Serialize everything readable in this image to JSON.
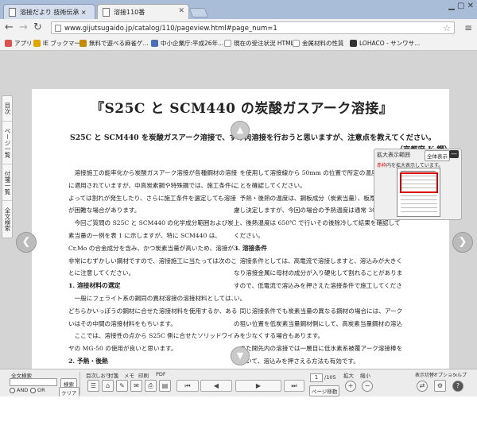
{
  "browser": {
    "tabs": [
      {
        "title": "溶接だより 技術伝承 ×"
      },
      {
        "title": "溶接110番"
      }
    ],
    "url": "www.gijutsugaido.jp/catalog/110/pageview.html#page_num=1",
    "bookmarks": [
      {
        "label": "アプリ",
        "color": "#d9534f"
      },
      {
        "label": "IE ブックマーク",
        "color": "#e0a400"
      },
      {
        "label": "無料で遊べる麻雀ゲ...",
        "color": "#c58b00"
      },
      {
        "label": "中小企業庁:平成26年...",
        "color": "#4a6fb5"
      },
      {
        "label": "現在の受注状況 HTML",
        "color": "#d0d0d0"
      },
      {
        "label": "金属材料の性質",
        "color": "#d0d0d0"
      },
      {
        "label": "LOHACO - サンワサ...",
        "color": "#333333"
      }
    ]
  },
  "sidebar": {
    "tabs": [
      "目次",
      "ページ一覧",
      "付箋一覧",
      "全文検索"
    ]
  },
  "page": {
    "title": "『S25C と SCM440 の炭酸ガスアーク溶接』",
    "lead": "S25C と SCM440 を炭酸ガスアーク溶接で、すみ肉溶接を行おうと思いますが、注意点を教えてください。",
    "author": "（京都府 K 鋼）",
    "col1": [
      {
        "type": "p",
        "text": "溶接施工の能率化から炭酸ガスアーク溶接が各種鋼材の溶接に適用されていますが、中高炭素鋼や特殊鋼では、施工条件によっては割れが発生したり、さらに施工条件を選定しても溶接が困難な場合があります。"
      },
      {
        "type": "p",
        "text": "今回ご質問の S25C と SCM440 の化学成分範囲および炭素当量の一例を表 1 に示しますが、特に SCM440 は、Cr,Mo の合金成分を含み、かつ炭素当量が高いため、溶接が非常にむずかしい鋼材ですので、溶接施工に当たっては次のことに注意してください。"
      },
      {
        "type": "h",
        "text": "1. 溶接材料の選定"
      },
      {
        "type": "p",
        "text": "一般にフェライト系の鋼同の異材溶接の溶接材料としては、どちらかいっぽうの鋼材に合せた溶接材料を使用するか、あるいはその中間の溶接材料をもちいます。"
      },
      {
        "type": "p",
        "text": "ここでは、溶接性の点から S25C 側に合せたソリッドワイヤの MG-50 の使用が良いと思います。"
      },
      {
        "type": "h",
        "text": "2. 予熱・後熱"
      },
      {
        "type": "p",
        "text": "溶接時の急熱、急冷により熱影響部や溶接金属が硬化して割れが発生することがありますので、これを防ぐ必"
      }
    ],
    "col2": [
      {
        "type": "p",
        "text": "を使用して溶接線から 50mm の位置で所定の温度になったことを確認してください。"
      },
      {
        "type": "p",
        "text": "予熱・後熱の温度は、鋼板成分（炭素当量）、板厚などを考慮し決定しますが、今回の場合の予熱温度は通常 300℃ 以上、後熱温度は 650℃ で行いその後除冷して結果を確認してください。"
      },
      {
        "type": "h",
        "text": "3. 溶接条件"
      },
      {
        "type": "p",
        "text": "溶接条件としては、高電流で溶接しますと、溶込みが大きくなり溶接金属に母材の成分が入り硬化して割れることがありますので、低電流で溶込みを押さえた溶接条件で施工してください。"
      },
      {
        "type": "p",
        "text": "同じ溶接条件でも炭素当量の異なる鋼材の場合には、アークの狙い位置を低炭素当量鋼材側にして、高炭素当量鋼材の溶込みを少なくする場合もあります。"
      },
      {
        "type": "p",
        "text": "また開先内の溶接では一層目に低水素系被覆アーク溶接棒をもちいて、溶込みを押さえる方法も有効です。"
      },
      {
        "type": "p",
        "text": "溶込が高く、溶込みが大きいため、割れが発生した溶接部の断面マクロを写真 1 に示します。これは予熱 300"
      }
    ]
  },
  "zoom_panel": {
    "title": "拡大表示範囲",
    "all_button": "全体表示",
    "min_button": "—",
    "msg_red": "赤枠",
    "msg_rest": "内を拡大表示しています。"
  },
  "toolbar": {
    "search_label": "全文検索",
    "search_button": "検索",
    "clear_button": "クリア",
    "and_label": "AND",
    "or_label": "OR",
    "tool_labels": [
      "目次",
      "しおり",
      "付箋",
      "メモ",
      "印刷",
      "PDF"
    ],
    "page_current": "1",
    "page_total": "/105",
    "page_jump": "ページ移動",
    "zoom_in_label": "拡大",
    "zoom_out_label": "縮小",
    "right_labels": [
      "表示切替",
      "オプション",
      "ヘルプ"
    ]
  }
}
